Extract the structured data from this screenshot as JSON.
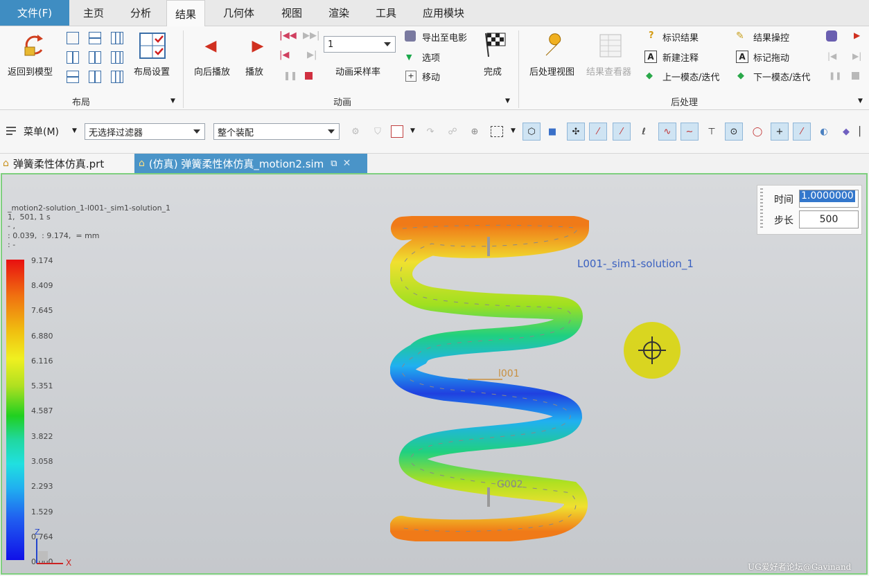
{
  "menubar": {
    "file": "文件(F)",
    "items": [
      "主页",
      "分析",
      "结果",
      "几何体",
      "视图",
      "渲染",
      "工具",
      "应用模块"
    ],
    "active": "结果"
  },
  "ribbon": {
    "layout_group": {
      "return_model": "返回到模型",
      "layout_settings": "布局设置",
      "label": "布局"
    },
    "animation_group": {
      "play_back": "向后播放",
      "play": "播放",
      "rate_value": "1",
      "rate_label": "动画采样率",
      "export_movie": "导出至电影",
      "options": "选项",
      "move": "移动",
      "finish": "完成",
      "label": "动画"
    },
    "post_group": {
      "post_view": "后处理视图",
      "result_viewer": "结果查看器",
      "identify_result": "标识结果",
      "new_annotation": "新建注释",
      "prev_mode": "上一模态/迭代",
      "result_probe": "结果操控",
      "mark_drag": "标记拖动",
      "next_mode": "下一模态/迭代",
      "label": "后处理"
    }
  },
  "toolbar": {
    "menu_label": "菜单(M)",
    "filter_value": "无选择过滤器",
    "assembly_value": "整个装配"
  },
  "doctabs": [
    {
      "label": "弹簧柔性体仿真.prt"
    },
    {
      "label": "(仿真) 弹簧柔性体仿真_motion2.sim"
    }
  ],
  "viewport": {
    "info_line1": "_motion2-solution_1-l001-_sim1-solution_1",
    "info_line2": "1,  501, 1 s",
    "info_line3": "- ,",
    "info_line4": ": 0.039,  : 9.174,  = mm",
    "info_line5": ": -",
    "legend_values": [
      "9.174",
      "8.409",
      "7.645",
      "6.880",
      "6.116",
      "5.351",
      "4.587",
      "3.822",
      "3.058",
      "2.293",
      "1.529",
      "0.764",
      "0.000"
    ],
    "label_solution": "L001-_sim1-solution_1",
    "label_l001": "l001",
    "label_g002": "G002",
    "time_label": "时间",
    "time_value": "1.0000000",
    "step_label": "步长",
    "step_value": "500",
    "axis_z": "Z",
    "axis_x": "X",
    "watermark": "UG爱好者论坛@Gavinand"
  }
}
